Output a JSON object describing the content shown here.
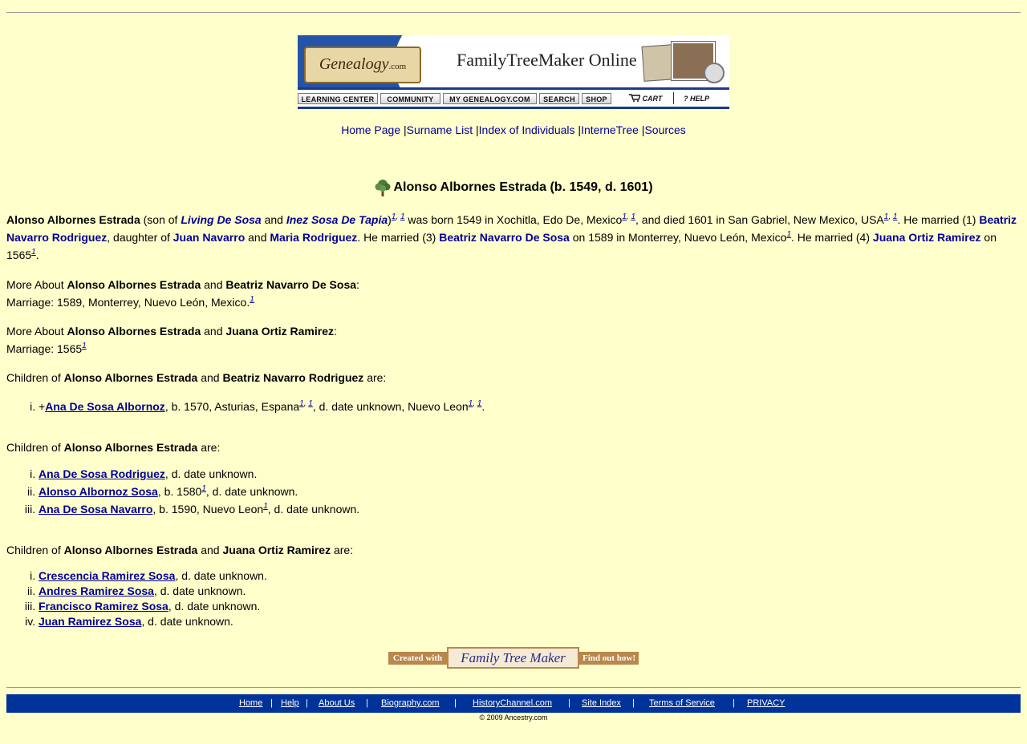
{
  "banner": {
    "logo_text": "Genealogy",
    "logo_suffix": ".com",
    "product_title": "FamilyTreeMaker Online",
    "nav": [
      "LEARNING CENTER",
      "COMMUNITY",
      "MY GENEALOGY.COM",
      "SEARCH",
      "SHOP",
      "CART",
      "? HELP"
    ]
  },
  "top_links": [
    "Home Page",
    "Surname List",
    "Index of Individuals",
    "InterneTree",
    "Sources"
  ],
  "title": "Alonso Albornes Estrada (b. 1549, d. 1601)",
  "bio": {
    "name": "Alonso Albornes Estrada",
    "son_of": "(son of ",
    "father": "Living De Sosa",
    "and": "and",
    "mother": "Inez Sosa De Tapia",
    "born": " was born 1549 in Xochitla, Edo De, Mexico",
    "died": ", and died 1601 in San Gabriel, New Mexico, USA",
    "married1": ". He married (1) ",
    "spouse1": "Beatriz Navarro Rodriguez",
    "daughter_of": ", daughter of ",
    "spouse1_father": "Juan Navarro",
    "spouse1_mother": "Maria Rodriguez",
    "married3": ". He married (3) ",
    "spouse3": "Beatriz Navarro De Sosa",
    "married3_place": " on 1589 in Monterrey, Nuevo León, Mexico",
    "married4": ". He married (4) ",
    "spouse4": "Juana Ortiz Ramirez",
    "married4_date": " on 1565",
    "cite": "1"
  },
  "more1": {
    "prefix": "More About ",
    "name": "Alonso Albornes Estrada",
    "spouse": "Beatriz Navarro De Sosa",
    "marriage": "Marriage: 1589, Monterrey, Nuevo León, Mexico."
  },
  "more2": {
    "prefix": "More About ",
    "name": "Alonso Albornes Estrada",
    "spouse": "Juana Ortiz Ramirez",
    "marriage": "Marriage: 1565"
  },
  "children_sections": [
    {
      "prefix": "Children of ",
      "parent": "Alonso Albornes Estrada",
      "spouse": "Beatriz Navarro Rodriguez",
      "suffix": " are:",
      "children": [
        {
          "plus": "+",
          "name": "Ana De Sosa Albornoz",
          "detail_a": ", b. 1570, Asturias, Espana",
          "detail_b": ", d. date unknown, Nuevo Leon",
          "end": "."
        }
      ]
    },
    {
      "prefix": "Children of ",
      "parent": "Alonso Albornes Estrada",
      "suffix": " are:",
      "children": [
        {
          "name": "Ana De Sosa Rodriguez",
          "detail": ", d. date unknown."
        },
        {
          "name": "Alonso Albornoz Sosa",
          "detail_a": ", b. 1580",
          "detail_b": ", d. date unknown."
        },
        {
          "name": "Ana De Sosa Navarro",
          "detail_a": ", b. 1590, Nuevo Leon",
          "detail_b": ", d. date unknown."
        }
      ]
    },
    {
      "prefix": "Children of ",
      "parent": "Alonso Albornes Estrada",
      "spouse": "Juana Ortiz Ramirez",
      "suffix": " are:",
      "children": [
        {
          "name": "Crescencia Ramirez Sosa",
          "detail": ", d. date unknown."
        },
        {
          "name": "Andres Ramirez Sosa",
          "detail": ", d. date unknown."
        },
        {
          "name": "Francisco Ramirez Sosa",
          "detail": ", d. date unknown."
        },
        {
          "name": "Juan Ramirez Sosa",
          "detail": ", d. date unknown."
        }
      ]
    }
  ],
  "created_with": {
    "left": "Created with",
    "center": "Family Tree Maker",
    "right": "Find out how!"
  },
  "footer": {
    "links": [
      "Home",
      "Help",
      "About Us",
      "Biography.com",
      "HistoryChannel.com",
      "Site Index",
      "Terms of Service",
      "PRIVACY"
    ],
    "separator": "|",
    "copyright": "© 2009 Ancestry.com"
  }
}
